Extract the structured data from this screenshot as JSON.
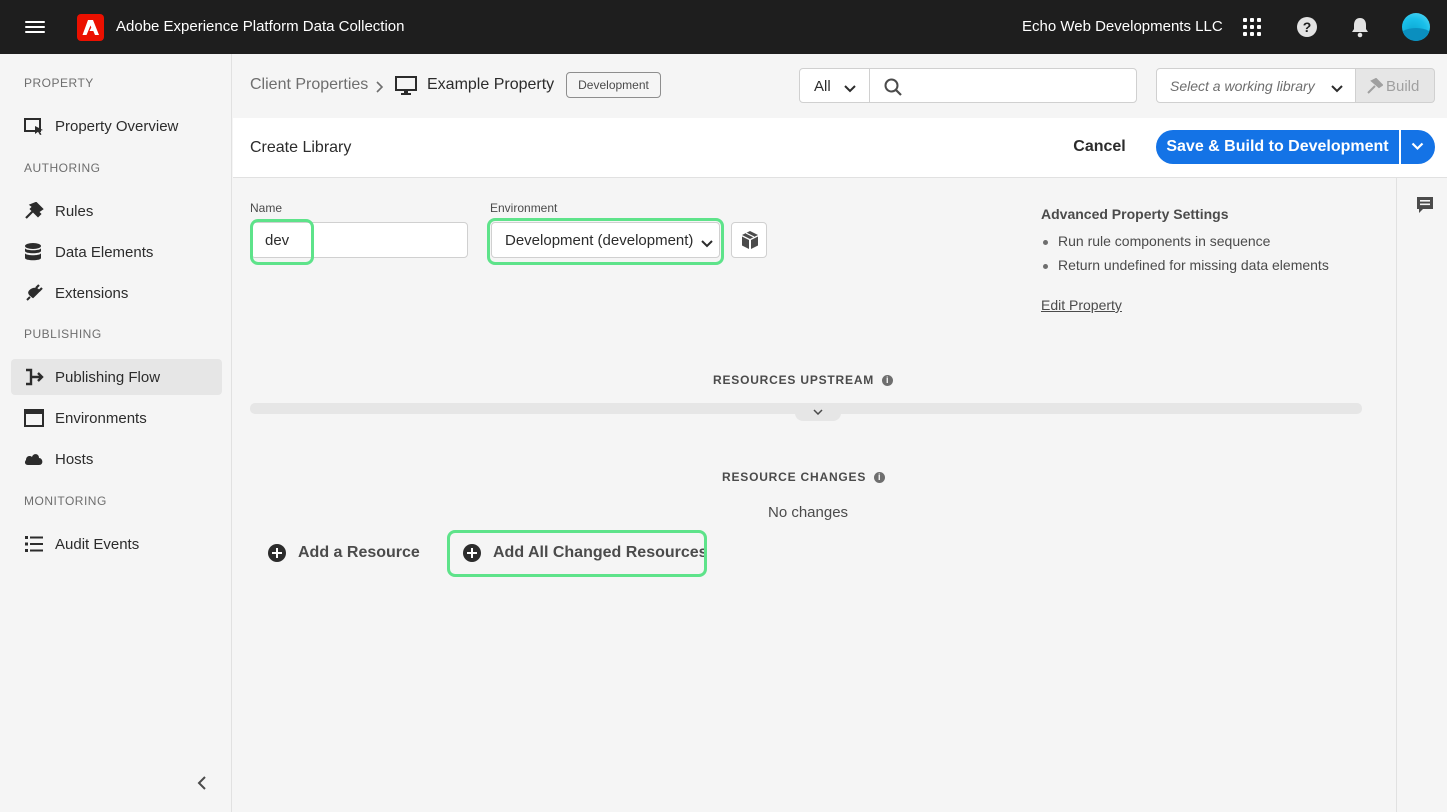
{
  "app": {
    "title": "Adobe Experience Platform Data Collection",
    "org": "Echo Web Developments LLC"
  },
  "sidebar": {
    "sections": [
      "PROPERTY",
      "AUTHORING",
      "PUBLISHING",
      "MONITORING"
    ],
    "items": [
      {
        "label": "Property Overview",
        "icon": "property-overview-icon"
      },
      {
        "label": "Rules",
        "icon": "rules-icon"
      },
      {
        "label": "Data Elements",
        "icon": "database-icon"
      },
      {
        "label": "Extensions",
        "icon": "plug-icon"
      },
      {
        "label": "Publishing Flow",
        "icon": "publishing-flow-icon",
        "active": true
      },
      {
        "label": "Environments",
        "icon": "window-icon"
      },
      {
        "label": "Hosts",
        "icon": "cloud-icon"
      },
      {
        "label": "Audit Events",
        "icon": "list-icon"
      }
    ]
  },
  "breadcrumb": {
    "parent": "Client Properties",
    "separator": ">",
    "current": "Example Property",
    "badge": "Development"
  },
  "search": {
    "filter": "All",
    "value": "",
    "placeholder": ""
  },
  "library": {
    "placeholder": "Select a working library",
    "build_label": "Build"
  },
  "toolbar": {
    "title": "Create Library",
    "cancel_label": "Cancel",
    "save_label": "Save & Build to Development"
  },
  "form": {
    "name_label": "Name",
    "name_value": "dev",
    "environment_label": "Environment",
    "environment_value": "Development (development)"
  },
  "advanced": {
    "title": "Advanced Property Settings",
    "items": [
      "Run rule components in sequence",
      "Return undefined for missing data elements"
    ],
    "edit_link": "Edit Property"
  },
  "resources": {
    "upstream_heading": "RESOURCES UPSTREAM",
    "changes_heading": "RESOURCE CHANGES",
    "no_changes": "No changes",
    "add_resource": "Add a Resource",
    "add_all_changed": "Add All Changed Resources"
  },
  "colors": {
    "accent": "#1473e6",
    "highlight": "#5ee38a",
    "adobe_red": "#eb1000"
  }
}
